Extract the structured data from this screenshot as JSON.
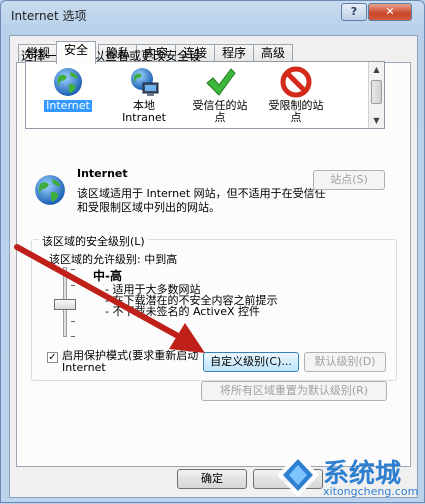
{
  "window": {
    "title": "Internet 选项",
    "help_label": "?",
    "close_label": "✕"
  },
  "tabs": [
    {
      "label": "常规"
    },
    {
      "label": "安全",
      "active": true
    },
    {
      "label": "隐私"
    },
    {
      "label": "内容"
    },
    {
      "label": "连接"
    },
    {
      "label": "程序"
    },
    {
      "label": "高级"
    }
  ],
  "security": {
    "instruction": "选择一个区域以查看或更改安全设",
    "zones": [
      {
        "line1": "Internet",
        "line2": "",
        "icon": "globe-icon",
        "selected": true
      },
      {
        "line1": "本地",
        "line2": "Intranet",
        "icon": "local-intranet-icon"
      },
      {
        "line1": "受信任的站",
        "line2": "点",
        "icon": "green-check-icon"
      },
      {
        "line1": "受限制的站",
        "line2": "点",
        "icon": "red-restricted-icon"
      }
    ],
    "selected_zone": {
      "name": "Internet",
      "description": "该区域适用于 Internet 网站，但不适用于在受信任和受限制区域中列出的网站。"
    },
    "sites_button": "站点(S)",
    "level_group_label": "该区域的安全级别(L)",
    "allowed_levels": "该区域的允许级别: 中到高",
    "level": {
      "name": "中-高",
      "bullets": [
        "- 适用于大多数网站",
        "- 在下载潜在的不安全内容之前提示",
        "- 不下载未签名的 ActiveX 控件"
      ]
    },
    "protected_mode": {
      "label": "启用保护模式(要求重新启动 Internet",
      "checked": true
    },
    "custom_level_button": "自定义级别(C)...",
    "default_level_button": "默认级别(D)",
    "reset_all_button": "将所有区域重置为默认级别(R)"
  },
  "footer": {
    "ok_button": "确定",
    "cancel_button": "取"
  },
  "watermark": {
    "text": "系统城",
    "url": "xitongcheng.com"
  },
  "colors": {
    "selection": "#3399ff",
    "annotation_arrow": "#c0201a",
    "watermark": "#2f7fd0"
  }
}
